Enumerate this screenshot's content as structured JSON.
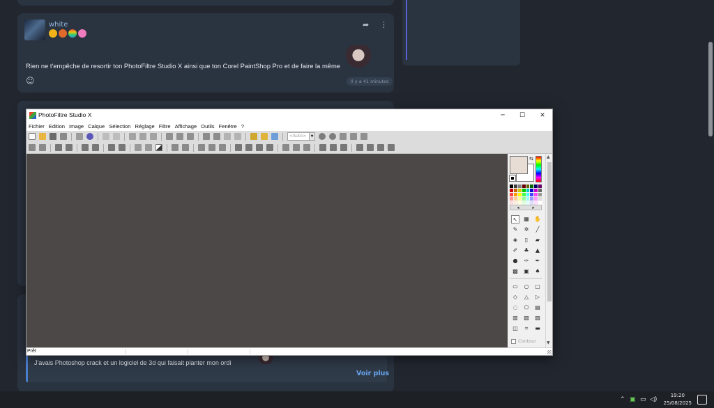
{
  "forum": {
    "post1": {
      "username": "white",
      "text": "Rien ne t'empêche de resortir ton PhotoFiltre Studio X ainsi que ton Corel PaintShop Pro et de faire la même",
      "timestamp": "Il y a 41 minutes",
      "share_icon": "share-icon",
      "more_icon": "more-vertical-icon",
      "react_icon": "add-reaction-icon"
    },
    "post3": {
      "quote_text": "J'avais Photoshop crack et un logiciel de 3d qui faisait planter mon ordi",
      "voir_plus": "Voir plus"
    },
    "colors": {
      "link": "#69a6ef",
      "username": "#8fb4dc",
      "card": "#2a3340",
      "accent": "#4a7fd0"
    }
  },
  "window": {
    "title": "PhotoFiltre Studio X",
    "controls": {
      "minimize": "─",
      "maximize": "☐",
      "close": "✕"
    },
    "menu": [
      "Fichier",
      "Edition",
      "Image",
      "Calque",
      "Sélection",
      "Réglage",
      "Filtre",
      "Affichage",
      "Outils",
      "Fenêtre",
      "?"
    ],
    "zoom_placeholder": "<Auto>",
    "contour_label": "Contour",
    "status": "Prêt",
    "workspace_color": "#4c4847",
    "foreground_color": "#e7ddd5",
    "background_color": "#ffffff"
  },
  "taskbar": {
    "time": "19:20",
    "date": "25/08/2025",
    "tray_icons": [
      "chevron-up-icon",
      "app-tray-icon",
      "network-icon",
      "volume-icon"
    ],
    "notification_icon": "notification-icon"
  }
}
